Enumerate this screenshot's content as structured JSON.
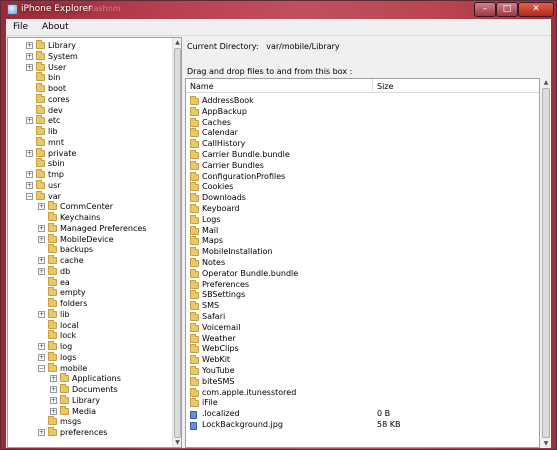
{
  "window": {
    "title": "iPhone Explorer",
    "background_title": "iRashnm",
    "minimize_glyph": "–",
    "maximize_glyph": "□",
    "close_glyph": "✕"
  },
  "menu": {
    "file": "File",
    "about": "About"
  },
  "tree": {
    "expand_glyph": "+",
    "collapse_glyph": "−",
    "items": [
      {
        "label": "Library",
        "exp": "+",
        "depth": 0
      },
      {
        "label": "System",
        "exp": "+",
        "depth": 0
      },
      {
        "label": "User",
        "exp": "+",
        "depth": 0
      },
      {
        "label": "bin",
        "exp": "",
        "depth": 0
      },
      {
        "label": "boot",
        "exp": "",
        "depth": 0
      },
      {
        "label": "cores",
        "exp": "",
        "depth": 0
      },
      {
        "label": "dev",
        "exp": "",
        "depth": 0
      },
      {
        "label": "etc",
        "exp": "+",
        "depth": 0
      },
      {
        "label": "lib",
        "exp": "",
        "depth": 0
      },
      {
        "label": "mnt",
        "exp": "",
        "depth": 0
      },
      {
        "label": "private",
        "exp": "+",
        "depth": 0
      },
      {
        "label": "sbin",
        "exp": "",
        "depth": 0
      },
      {
        "label": "tmp",
        "exp": "+",
        "depth": 0
      },
      {
        "label": "usr",
        "exp": "+",
        "depth": 0
      },
      {
        "label": "var",
        "exp": "−",
        "depth": 0
      },
      {
        "label": "CommCenter",
        "exp": "+",
        "depth": 1
      },
      {
        "label": "Keychains",
        "exp": "",
        "depth": 1
      },
      {
        "label": "Managed Preferences",
        "exp": "+",
        "depth": 1
      },
      {
        "label": "MobileDevice",
        "exp": "+",
        "depth": 1
      },
      {
        "label": "backups",
        "exp": "",
        "depth": 1
      },
      {
        "label": "cache",
        "exp": "+",
        "depth": 1
      },
      {
        "label": "db",
        "exp": "+",
        "depth": 1
      },
      {
        "label": "ea",
        "exp": "",
        "depth": 1
      },
      {
        "label": "empty",
        "exp": "",
        "depth": 1
      },
      {
        "label": "folders",
        "exp": "",
        "depth": 1
      },
      {
        "label": "lib",
        "exp": "+",
        "depth": 1
      },
      {
        "label": "local",
        "exp": "",
        "depth": 1
      },
      {
        "label": "lock",
        "exp": "",
        "depth": 1
      },
      {
        "label": "log",
        "exp": "+",
        "depth": 1
      },
      {
        "label": "logs",
        "exp": "+",
        "depth": 1
      },
      {
        "label": "mobile",
        "exp": "−",
        "depth": 1
      },
      {
        "label": "Applications",
        "exp": "+",
        "depth": 2
      },
      {
        "label": "Documents",
        "exp": "+",
        "depth": 2
      },
      {
        "label": "Library",
        "exp": "+",
        "depth": 2
      },
      {
        "label": "Media",
        "exp": "+",
        "depth": 2
      },
      {
        "label": "msgs",
        "exp": "",
        "depth": 1
      },
      {
        "label": "preferences",
        "exp": "+",
        "depth": 1
      }
    ]
  },
  "current_directory": {
    "label": "Current Directory:",
    "path": "var/mobile/Library"
  },
  "drag_drop_label": "Drag and drop files to and from this box :",
  "list": {
    "headers": {
      "name": "Name",
      "size": "Size"
    },
    "rows": [
      {
        "name": "AddressBook",
        "size": "",
        "type": "folder"
      },
      {
        "name": "AppBackup",
        "size": "",
        "type": "folder"
      },
      {
        "name": "Caches",
        "size": "",
        "type": "folder"
      },
      {
        "name": "Calendar",
        "size": "",
        "type": "folder"
      },
      {
        "name": "CallHistory",
        "size": "",
        "type": "folder"
      },
      {
        "name": "Carrier Bundle.bundle",
        "size": "",
        "type": "folder"
      },
      {
        "name": "Carrier Bundles",
        "size": "",
        "type": "folder"
      },
      {
        "name": "ConfigurationProfiles",
        "size": "",
        "type": "folder"
      },
      {
        "name": "Cookies",
        "size": "",
        "type": "folder"
      },
      {
        "name": "Downloads",
        "size": "",
        "type": "folder"
      },
      {
        "name": "Keyboard",
        "size": "",
        "type": "folder"
      },
      {
        "name": "Logs",
        "size": "",
        "type": "folder"
      },
      {
        "name": "Mail",
        "size": "",
        "type": "folder"
      },
      {
        "name": "Maps",
        "size": "",
        "type": "folder"
      },
      {
        "name": "MobileInstallation",
        "size": "",
        "type": "folder"
      },
      {
        "name": "Notes",
        "size": "",
        "type": "folder"
      },
      {
        "name": "Operator Bundle.bundle",
        "size": "",
        "type": "folder"
      },
      {
        "name": "Preferences",
        "size": "",
        "type": "folder"
      },
      {
        "name": "SBSettings",
        "size": "",
        "type": "folder"
      },
      {
        "name": "SMS",
        "size": "",
        "type": "folder"
      },
      {
        "name": "Safari",
        "size": "",
        "type": "folder"
      },
      {
        "name": "Voicemail",
        "size": "",
        "type": "folder"
      },
      {
        "name": "Weather",
        "size": "",
        "type": "folder"
      },
      {
        "name": "WebClips",
        "size": "",
        "type": "folder"
      },
      {
        "name": "WebKit",
        "size": "",
        "type": "folder"
      },
      {
        "name": "YouTube",
        "size": "",
        "type": "folder"
      },
      {
        "name": "biteSMS",
        "size": "",
        "type": "folder"
      },
      {
        "name": "com.apple.itunesstored",
        "size": "",
        "type": "folder"
      },
      {
        "name": "iFile",
        "size": "",
        "type": "folder"
      },
      {
        "name": ".localized",
        "size": "0 B",
        "type": "file"
      },
      {
        "name": "LockBackground.jpg",
        "size": "58 KB",
        "type": "file"
      }
    ]
  },
  "colors": {
    "titlebar": "#b84050",
    "folder": "#e8c86a",
    "file": "#6a8ecf"
  }
}
